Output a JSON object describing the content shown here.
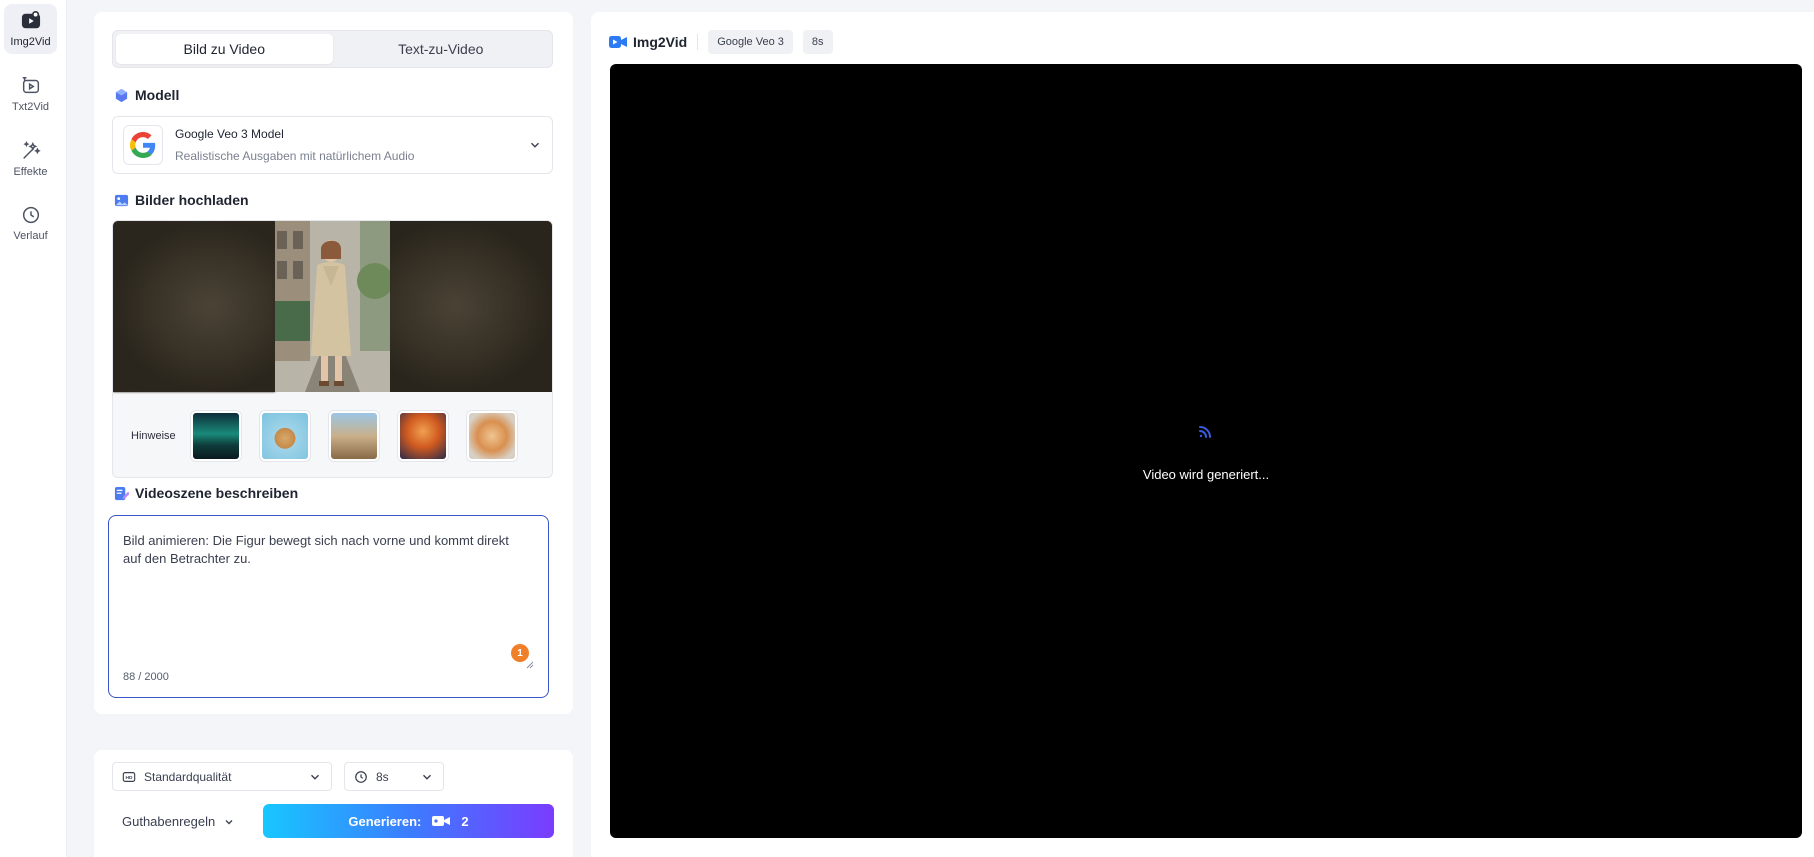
{
  "sidebar": {
    "items": [
      {
        "label": "Img2Vid",
        "icon": "image-video-icon"
      },
      {
        "label": "Txt2Vid",
        "icon": "text-video-icon"
      },
      {
        "label": "Effekte",
        "icon": "magic-wand-icon"
      },
      {
        "label": "Verlauf",
        "icon": "clock-icon"
      }
    ]
  },
  "tabs": [
    "Bild zu Video",
    "Text-zu-Video"
  ],
  "model": {
    "section_title": "Modell",
    "name": "Google Veo 3 Model",
    "description": "Realistische Ausgaben mit natürlichem Audio"
  },
  "upload": {
    "section_title": "Bilder hochladen",
    "hints_label": "Hinweise"
  },
  "prompt": {
    "section_title": "Videoszene beschreiben",
    "value": "Bild animieren: Die Figur bewegt sich nach vorne und kommt direkt auf den Betrachter zu.",
    "counter": "88 / 2000",
    "badge": "1"
  },
  "controls": {
    "quality": "Standardqualität",
    "duration": "8s",
    "credits_label": "Guthabenregeln",
    "generate_label": "Generieren:",
    "generate_cost": "2"
  },
  "preview_panel": {
    "brand": "Img2Vid",
    "model_chip": "Google Veo 3",
    "duration_chip": "8s",
    "status": "Video wird generiert..."
  },
  "colors": {
    "accent": "#3b55c8",
    "badge": "#f07f2a",
    "gradient_start": "#18c7ff",
    "gradient_end": "#7a3cff"
  }
}
